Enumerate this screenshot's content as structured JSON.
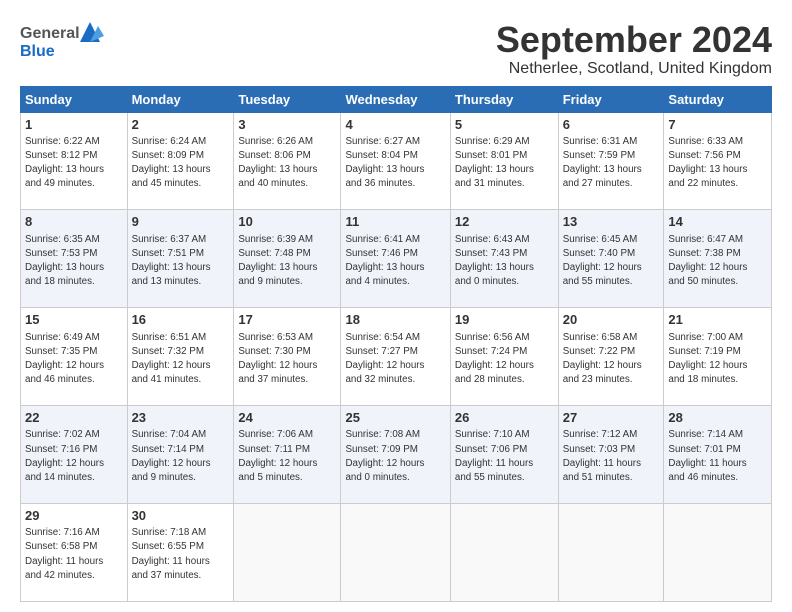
{
  "logo": {
    "line1": "General",
    "line2": "Blue"
  },
  "title": "September 2024",
  "subtitle": "Netherlee, Scotland, United Kingdom",
  "calendar": {
    "headers": [
      "Sunday",
      "Monday",
      "Tuesday",
      "Wednesday",
      "Thursday",
      "Friday",
      "Saturday"
    ],
    "rows": [
      [
        {
          "day": "1",
          "info": "Sunrise: 6:22 AM\nSunset: 8:12 PM\nDaylight: 13 hours\nand 49 minutes."
        },
        {
          "day": "2",
          "info": "Sunrise: 6:24 AM\nSunset: 8:09 PM\nDaylight: 13 hours\nand 45 minutes."
        },
        {
          "day": "3",
          "info": "Sunrise: 6:26 AM\nSunset: 8:06 PM\nDaylight: 13 hours\nand 40 minutes."
        },
        {
          "day": "4",
          "info": "Sunrise: 6:27 AM\nSunset: 8:04 PM\nDaylight: 13 hours\nand 36 minutes."
        },
        {
          "day": "5",
          "info": "Sunrise: 6:29 AM\nSunset: 8:01 PM\nDaylight: 13 hours\nand 31 minutes."
        },
        {
          "day": "6",
          "info": "Sunrise: 6:31 AM\nSunset: 7:59 PM\nDaylight: 13 hours\nand 27 minutes."
        },
        {
          "day": "7",
          "info": "Sunrise: 6:33 AM\nSunset: 7:56 PM\nDaylight: 13 hours\nand 22 minutes."
        }
      ],
      [
        {
          "day": "8",
          "info": "Sunrise: 6:35 AM\nSunset: 7:53 PM\nDaylight: 13 hours\nand 18 minutes."
        },
        {
          "day": "9",
          "info": "Sunrise: 6:37 AM\nSunset: 7:51 PM\nDaylight: 13 hours\nand 13 minutes."
        },
        {
          "day": "10",
          "info": "Sunrise: 6:39 AM\nSunset: 7:48 PM\nDaylight: 13 hours\nand 9 minutes."
        },
        {
          "day": "11",
          "info": "Sunrise: 6:41 AM\nSunset: 7:46 PM\nDaylight: 13 hours\nand 4 minutes."
        },
        {
          "day": "12",
          "info": "Sunrise: 6:43 AM\nSunset: 7:43 PM\nDaylight: 13 hours\nand 0 minutes."
        },
        {
          "day": "13",
          "info": "Sunrise: 6:45 AM\nSunset: 7:40 PM\nDaylight: 12 hours\nand 55 minutes."
        },
        {
          "day": "14",
          "info": "Sunrise: 6:47 AM\nSunset: 7:38 PM\nDaylight: 12 hours\nand 50 minutes."
        }
      ],
      [
        {
          "day": "15",
          "info": "Sunrise: 6:49 AM\nSunset: 7:35 PM\nDaylight: 12 hours\nand 46 minutes."
        },
        {
          "day": "16",
          "info": "Sunrise: 6:51 AM\nSunset: 7:32 PM\nDaylight: 12 hours\nand 41 minutes."
        },
        {
          "day": "17",
          "info": "Sunrise: 6:53 AM\nSunset: 7:30 PM\nDaylight: 12 hours\nand 37 minutes."
        },
        {
          "day": "18",
          "info": "Sunrise: 6:54 AM\nSunset: 7:27 PM\nDaylight: 12 hours\nand 32 minutes."
        },
        {
          "day": "19",
          "info": "Sunrise: 6:56 AM\nSunset: 7:24 PM\nDaylight: 12 hours\nand 28 minutes."
        },
        {
          "day": "20",
          "info": "Sunrise: 6:58 AM\nSunset: 7:22 PM\nDaylight: 12 hours\nand 23 minutes."
        },
        {
          "day": "21",
          "info": "Sunrise: 7:00 AM\nSunset: 7:19 PM\nDaylight: 12 hours\nand 18 minutes."
        }
      ],
      [
        {
          "day": "22",
          "info": "Sunrise: 7:02 AM\nSunset: 7:16 PM\nDaylight: 12 hours\nand 14 minutes."
        },
        {
          "day": "23",
          "info": "Sunrise: 7:04 AM\nSunset: 7:14 PM\nDaylight: 12 hours\nand 9 minutes."
        },
        {
          "day": "24",
          "info": "Sunrise: 7:06 AM\nSunset: 7:11 PM\nDaylight: 12 hours\nand 5 minutes."
        },
        {
          "day": "25",
          "info": "Sunrise: 7:08 AM\nSunset: 7:09 PM\nDaylight: 12 hours\nand 0 minutes."
        },
        {
          "day": "26",
          "info": "Sunrise: 7:10 AM\nSunset: 7:06 PM\nDaylight: 11 hours\nand 55 minutes."
        },
        {
          "day": "27",
          "info": "Sunrise: 7:12 AM\nSunset: 7:03 PM\nDaylight: 11 hours\nand 51 minutes."
        },
        {
          "day": "28",
          "info": "Sunrise: 7:14 AM\nSunset: 7:01 PM\nDaylight: 11 hours\nand 46 minutes."
        }
      ],
      [
        {
          "day": "29",
          "info": "Sunrise: 7:16 AM\nSunset: 6:58 PM\nDaylight: 11 hours\nand 42 minutes."
        },
        {
          "day": "30",
          "info": "Sunrise: 7:18 AM\nSunset: 6:55 PM\nDaylight: 11 hours\nand 37 minutes."
        },
        {
          "day": "",
          "info": ""
        },
        {
          "day": "",
          "info": ""
        },
        {
          "day": "",
          "info": ""
        },
        {
          "day": "",
          "info": ""
        },
        {
          "day": "",
          "info": ""
        }
      ]
    ]
  }
}
